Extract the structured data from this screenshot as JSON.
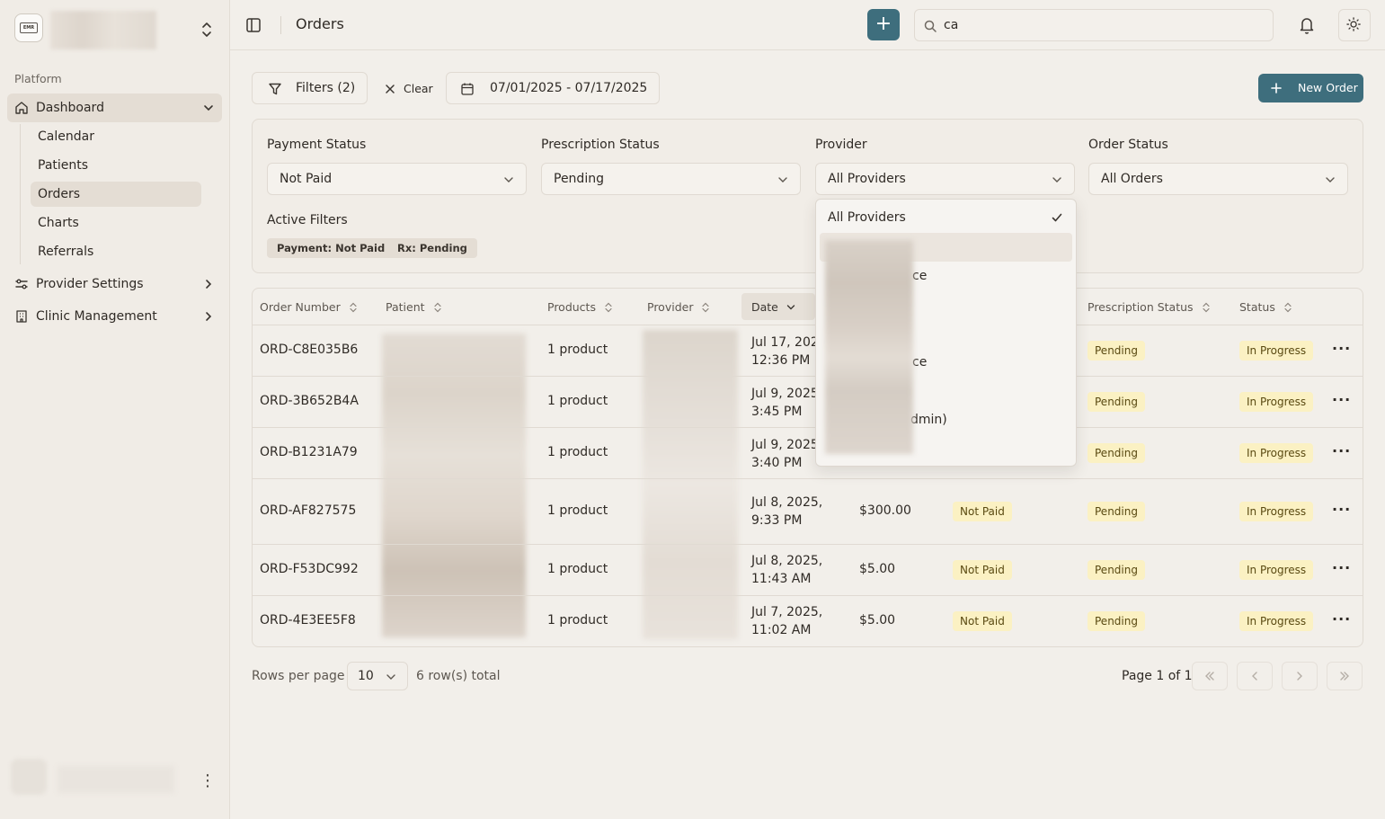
{
  "sidebar": {
    "section_label": "Platform",
    "dashboard_label": "Dashboard",
    "sub_items": [
      "Calendar",
      "Patients",
      "Orders",
      "Charts",
      "Referrals"
    ],
    "provider_settings_label": "Provider Settings",
    "clinic_management_label": "Clinic Management"
  },
  "topbar": {
    "title": "Orders",
    "search_value": "ca"
  },
  "toolbar": {
    "filters_label": "Filters (2)",
    "clear_label": "Clear",
    "date_range": "07/01/2025 - 07/17/2025",
    "new_order_label": "New Order"
  },
  "filters": {
    "payment_status": {
      "label": "Payment Status",
      "value": "Not Paid"
    },
    "prescription_status": {
      "label": "Prescription Status",
      "value": "Pending"
    },
    "provider": {
      "label": "Provider",
      "value": "All Providers"
    },
    "order_status": {
      "label": "Order Status",
      "value": "All Orders"
    },
    "active_filters_label": "Active Filters",
    "chips": [
      "Payment: Not Paid",
      "Rx: Pending"
    ]
  },
  "provider_dropdown": {
    "selected": "All Providers",
    "partial_texts": [
      "ce",
      "ce",
      "dmin)"
    ]
  },
  "table": {
    "headers": [
      "Order Number",
      "Patient",
      "Products",
      "Provider",
      "Date",
      "Prescription Status",
      "Status"
    ],
    "rows": [
      {
        "order": "ORD-C8E035B6",
        "products": "1 product",
        "date1": "Jul 17, 202",
        "date2": "12:36 PM",
        "amount": "",
        "payment": "",
        "rx": "Pending",
        "status": "In Progress"
      },
      {
        "order": "ORD-3B652B4A",
        "products": "1 product",
        "date1": "Jul 9, 2025",
        "date2": "3:45 PM",
        "amount": "",
        "payment": "",
        "rx": "Pending",
        "status": "In Progress"
      },
      {
        "order": "ORD-B1231A79",
        "products": "1 product",
        "date1": "Jul 9, 2025",
        "date2": "3:40 PM",
        "amount": "",
        "payment": "",
        "rx": "Pending",
        "status": "In Progress"
      },
      {
        "order": "ORD-AF827575",
        "products": "1 product",
        "date1": "Jul 8, 2025,",
        "date2": "9:33 PM",
        "amount": "$300.00",
        "payment": "Not Paid",
        "rx": "Pending",
        "status": "In Progress"
      },
      {
        "order": "ORD-F53DC992",
        "products": "1 product",
        "date1": "Jul 8, 2025,",
        "date2": "11:43 AM",
        "amount": "$5.00",
        "payment": "Not Paid",
        "rx": "Pending",
        "status": "In Progress"
      },
      {
        "order": "ORD-4E3EE5F8",
        "products": "1 product",
        "date1": "Jul 7, 2025,",
        "date2": "11:02 AM",
        "amount": "$5.00",
        "payment": "Not Paid",
        "rx": "Pending",
        "status": "In Progress"
      }
    ]
  },
  "pagination": {
    "rows_label": "Rows per page",
    "rows_value": "10",
    "total": "6 row(s) total",
    "page_info": "Page 1 of 1"
  },
  "colors": {
    "accent": "#3e6e7d",
    "badge_bg": "#fbf1c3",
    "background": "#f2efea"
  }
}
